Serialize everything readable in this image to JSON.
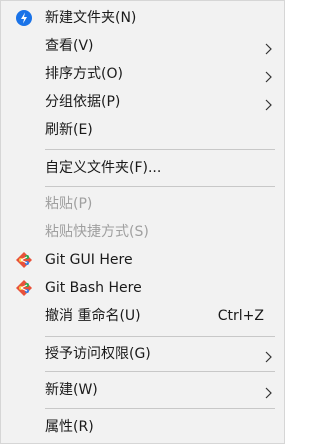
{
  "menu": {
    "items": [
      {
        "label": "新建文件夹(N)",
        "icon": "new-folder-icon",
        "enabled": true
      },
      {
        "label": "查看(V)",
        "submenu": true,
        "enabled": true
      },
      {
        "label": "排序方式(O)",
        "submenu": true,
        "enabled": true
      },
      {
        "label": "分组依据(P)",
        "submenu": true,
        "enabled": true
      },
      {
        "label": "刷新(E)",
        "enabled": true
      },
      {
        "label": "自定义文件夹(F)...",
        "enabled": true
      },
      {
        "label": "粘贴(P)",
        "enabled": false
      },
      {
        "label": "粘贴快捷方式(S)",
        "enabled": false
      },
      {
        "label": "Git GUI Here",
        "icon": "git-icon",
        "enabled": true
      },
      {
        "label": "Git Bash Here",
        "icon": "git-icon",
        "enabled": true
      },
      {
        "label": "撤消 重命名(U)",
        "shortcut": "Ctrl+Z",
        "enabled": true
      },
      {
        "label": "授予访问权限(G)",
        "submenu": true,
        "enabled": true
      },
      {
        "label": "新建(W)",
        "submenu": true,
        "enabled": true
      },
      {
        "label": "属性(R)",
        "enabled": true
      }
    ]
  },
  "colors": {
    "background": "#f2f2f2",
    "text": "#1a1a1a",
    "disabled_text": "#a0a0a0",
    "separator": "#c8c8c8",
    "new_folder_icon": "#1a73e8"
  }
}
